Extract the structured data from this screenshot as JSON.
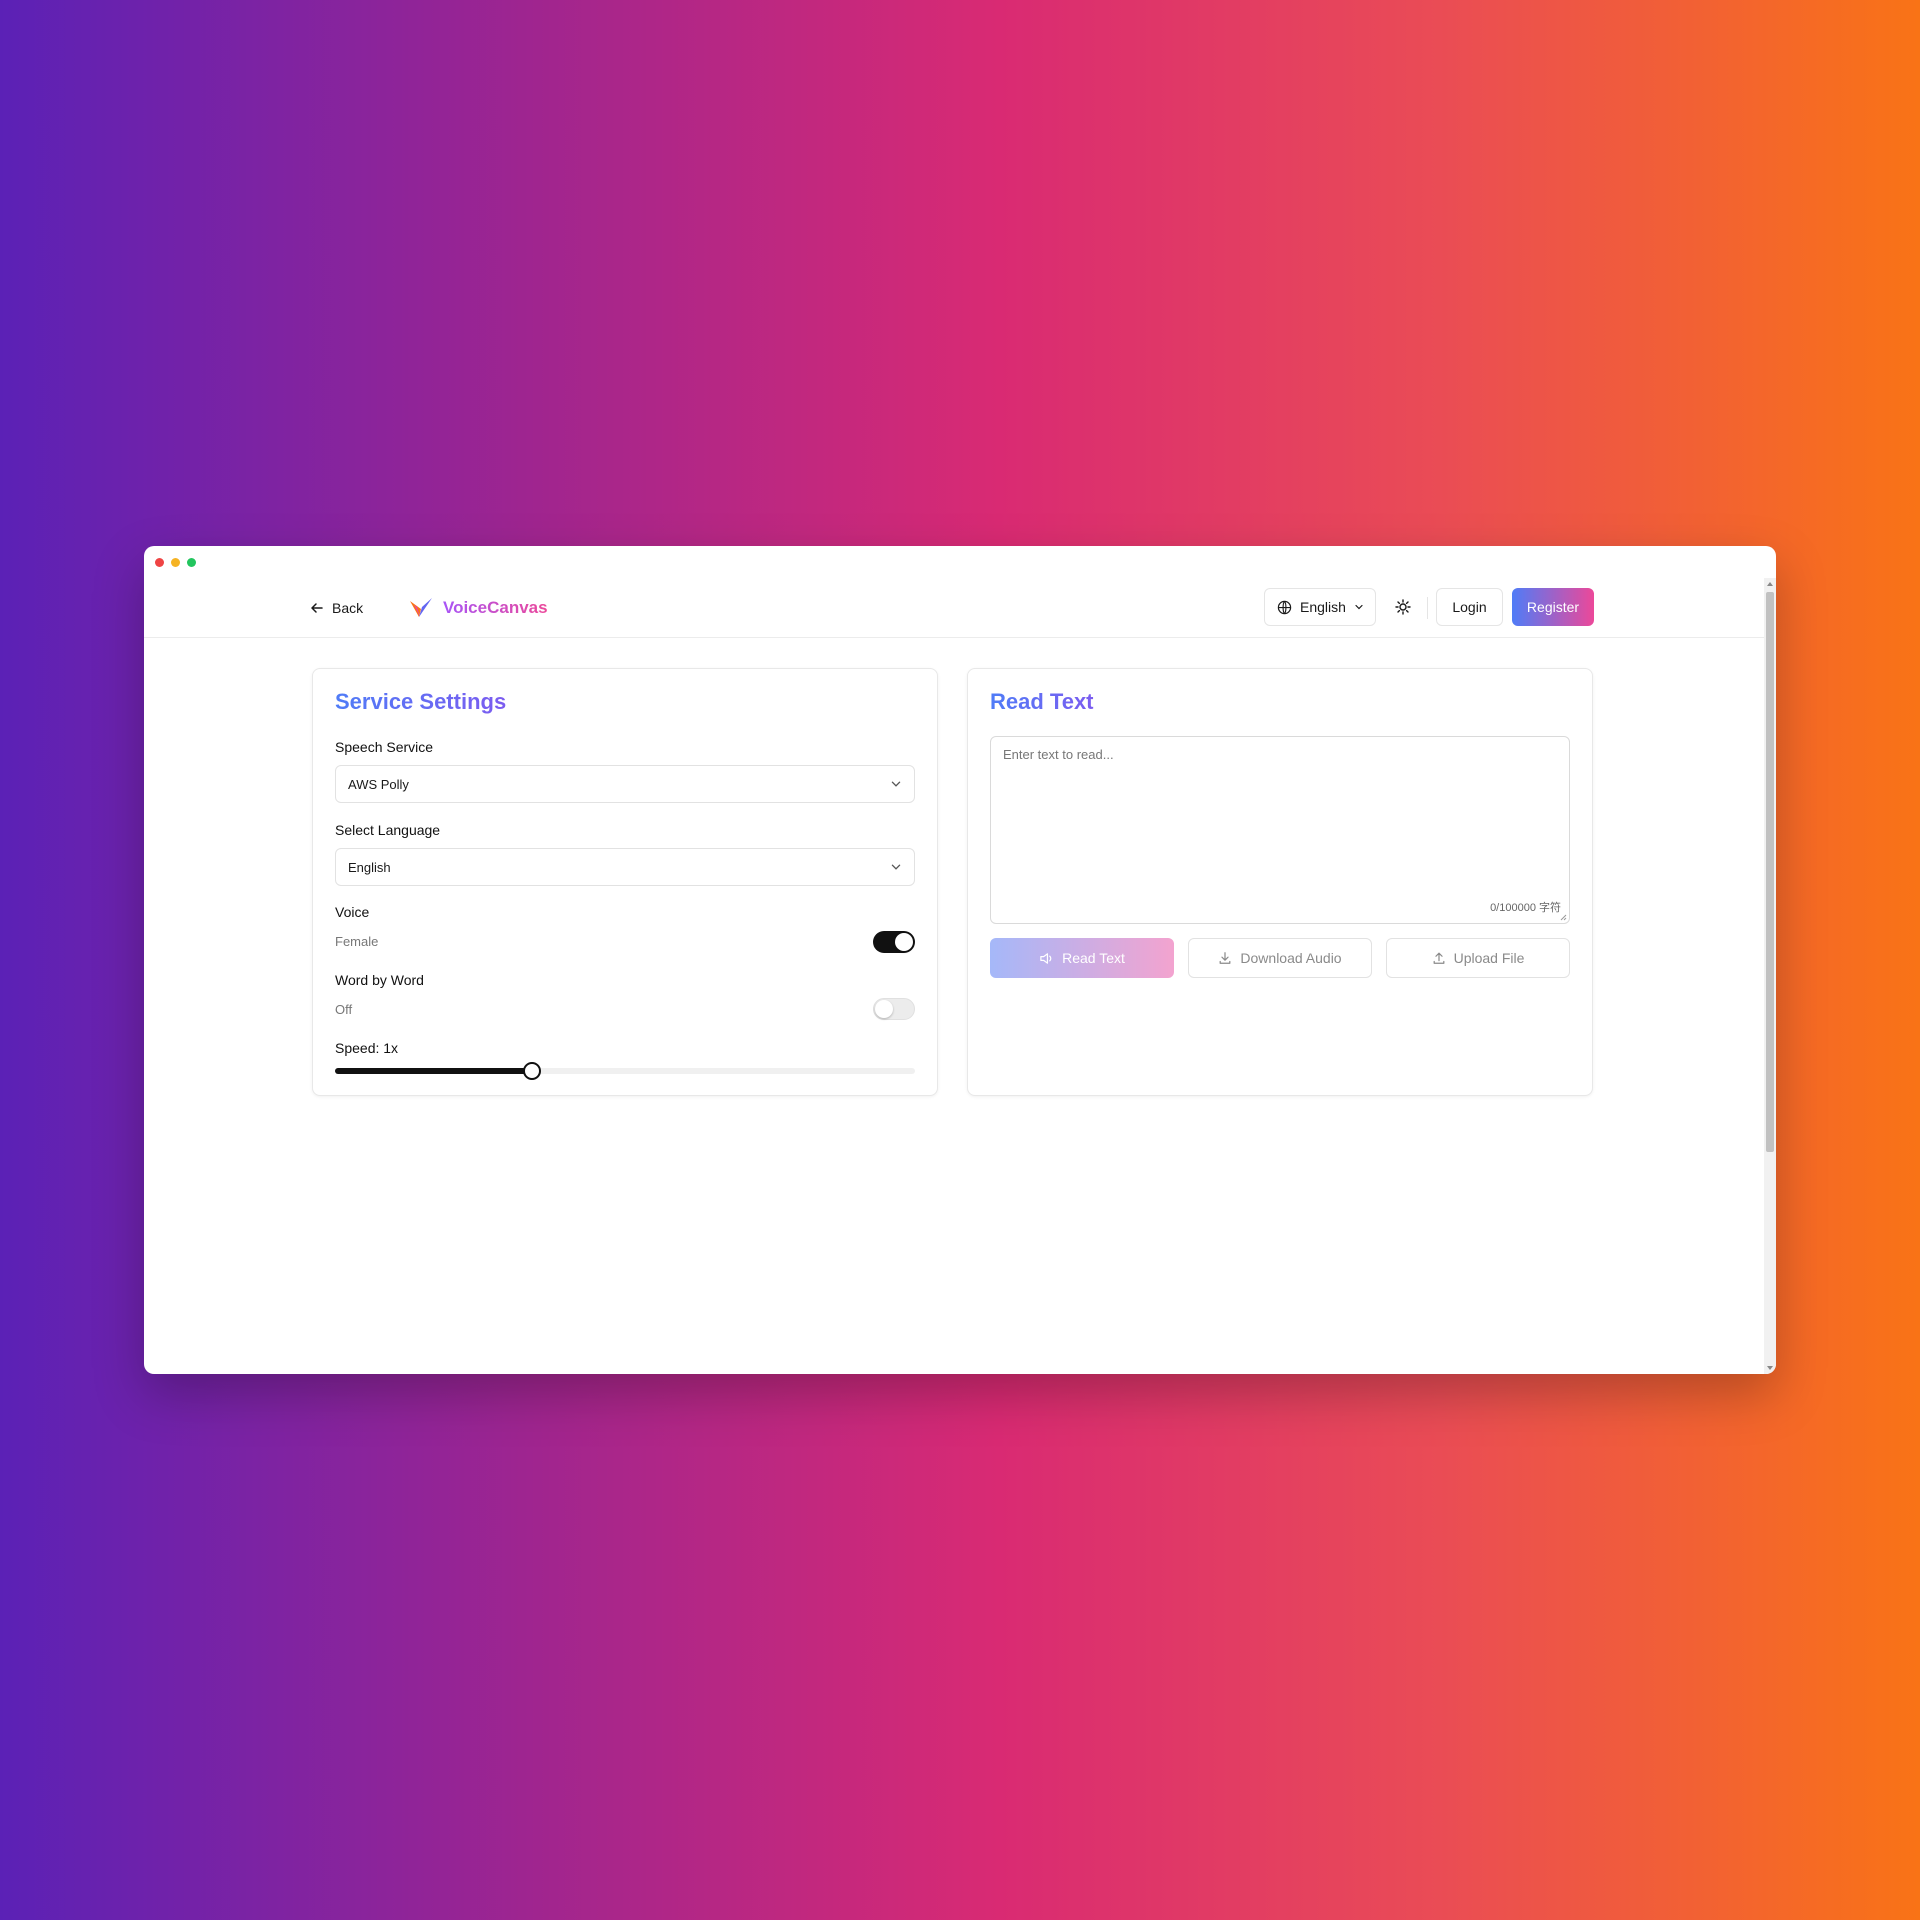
{
  "header": {
    "back_label": "Back",
    "app_name": "VoiceCanvas",
    "language": "English",
    "login_label": "Login",
    "register_label": "Register"
  },
  "settings": {
    "title": "Service Settings",
    "speech_service_label": "Speech Service",
    "speech_service_value": "AWS Polly",
    "language_label": "Select Language",
    "language_value": "English",
    "voice_label": "Voice",
    "voice_value": "Female",
    "voice_toggle_on": true,
    "word_by_word_label": "Word by Word",
    "word_by_word_value": "Off",
    "word_by_word_toggle_on": false,
    "speed_label": "Speed: 1x",
    "speed_fraction": 0.34
  },
  "reader": {
    "title": "Read Text",
    "placeholder": "Enter text to read...",
    "char_count": "0/100000 字符",
    "read_button": "Read Text",
    "download_button": "Download Audio",
    "upload_button": "Upload File"
  },
  "colors": {
    "accent_blue": "#4f7cf7",
    "accent_pink": "#ec4899",
    "toggle_on": "#111111"
  },
  "icons": {
    "back": "arrow-left-icon",
    "logo": "logo-icon",
    "language": "globe-icon",
    "theme": "sun-icon",
    "read": "speaker-icon",
    "download": "download-icon",
    "upload": "upload-icon"
  }
}
